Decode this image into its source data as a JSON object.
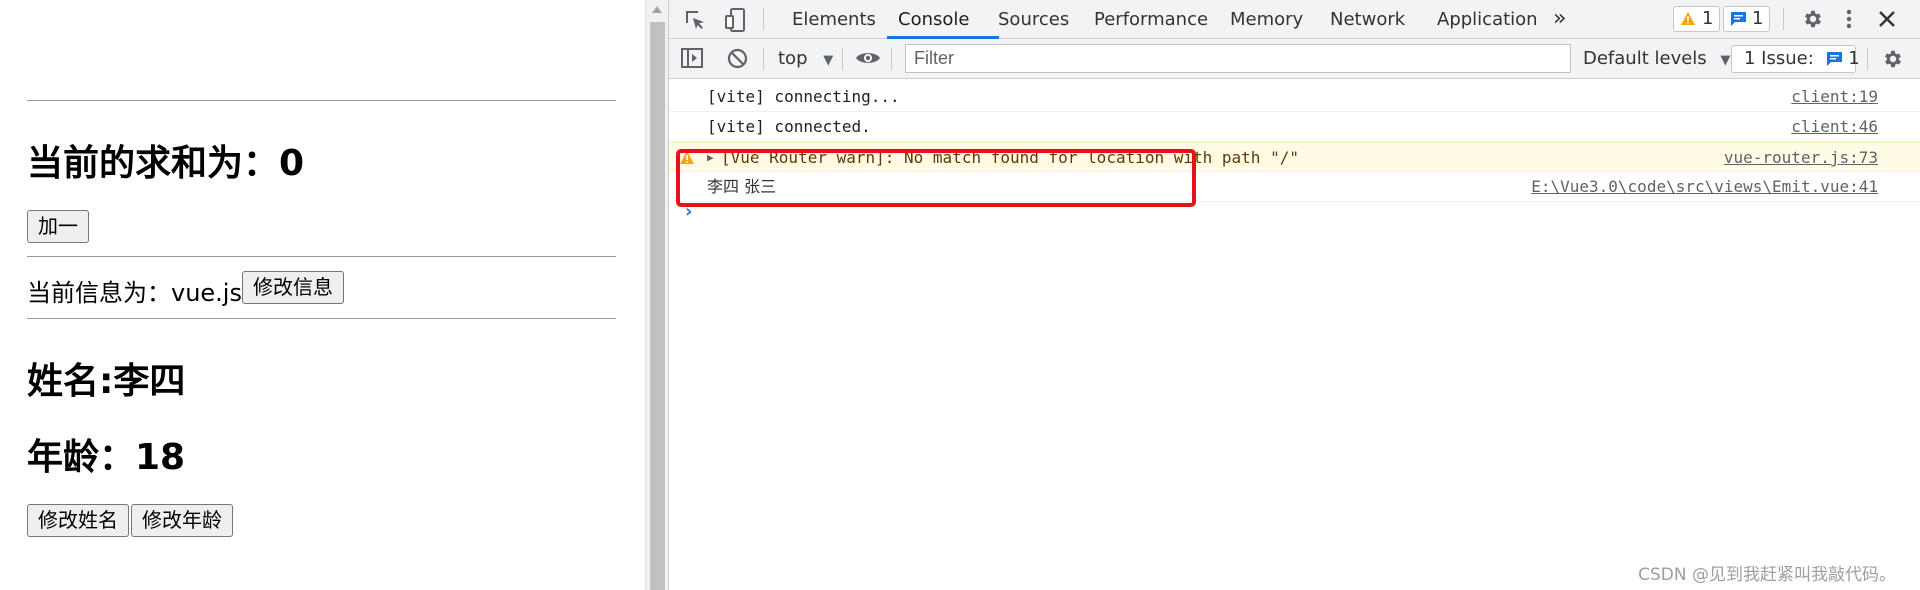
{
  "app": {
    "sum_heading": "当前的求和为：0",
    "add_button": "加一",
    "info_text": "当前信息为：vue.js",
    "edit_info_button": "修改信息",
    "name_heading": "姓名:李四",
    "age_heading": "年龄：18",
    "edit_name_button": "修改姓名",
    "edit_age_button": "修改年龄"
  },
  "devtools": {
    "tabs": [
      "Elements",
      "Console",
      "Sources",
      "Performance",
      "Memory",
      "Network",
      "Application"
    ],
    "active_tab": "Console",
    "more_tabs": "»",
    "warning_badge_count": "1",
    "message_badge_count": "1",
    "toolbar": {
      "context": "top",
      "filter_placeholder": "Filter",
      "levels": "Default levels",
      "issues": "1 Issue:",
      "issues_count": "1"
    },
    "console_rows": [
      {
        "text": "[vite] connecting...",
        "source": "client:19",
        "level": "log"
      },
      {
        "text": "[vite] connected.",
        "source": "client:46",
        "level": "log"
      },
      {
        "text": "[Vue Router warn]: No match found for location with path \"/\"",
        "source": "vue-router.js:73",
        "level": "warn"
      },
      {
        "text": "李四 张三",
        "source": "E:\\Vue3.0\\code\\src\\views\\Emit.vue:41",
        "level": "log"
      }
    ],
    "accent": "#1a73e8",
    "highlight_color": "#e8101a"
  },
  "watermark": "CSDN @见到我赶紧叫我敲代码。"
}
